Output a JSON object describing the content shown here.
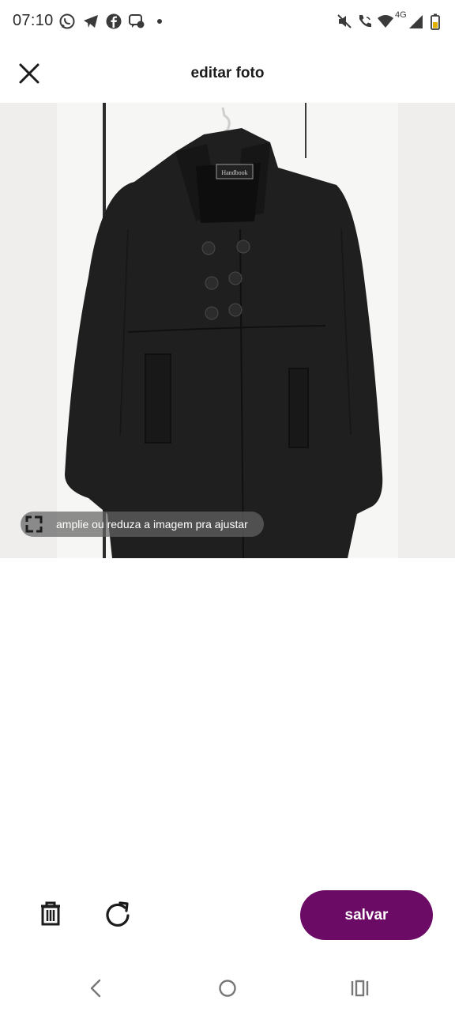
{
  "status_bar": {
    "time": "07:10",
    "left_icons": [
      "whatsapp-icon",
      "telegram-icon",
      "facebook-icon",
      "chat-icon",
      "notification-dot"
    ],
    "network_label": "4G",
    "right_icons": [
      "mute-icon",
      "wifi-calling-icon",
      "wifi-icon",
      "signal-icon",
      "battery-icon"
    ]
  },
  "header": {
    "title": "editar foto",
    "close_icon": "close-icon"
  },
  "photo": {
    "label_text": "Handbook",
    "hint_text": "amplie ou reduza a imagem pra ajustar",
    "hint_icon": "crop-resize-icon"
  },
  "toolbar": {
    "delete_icon": "trash-icon",
    "rotate_icon": "rotate-icon",
    "save_label": "salvar"
  },
  "nav_bar": {
    "icons": [
      "back-icon",
      "home-icon",
      "recents-icon"
    ]
  },
  "colors": {
    "accent": "#6c0b66",
    "background": "#ffffff",
    "photo_background": "#efeeec",
    "hint_background": "#646464"
  }
}
